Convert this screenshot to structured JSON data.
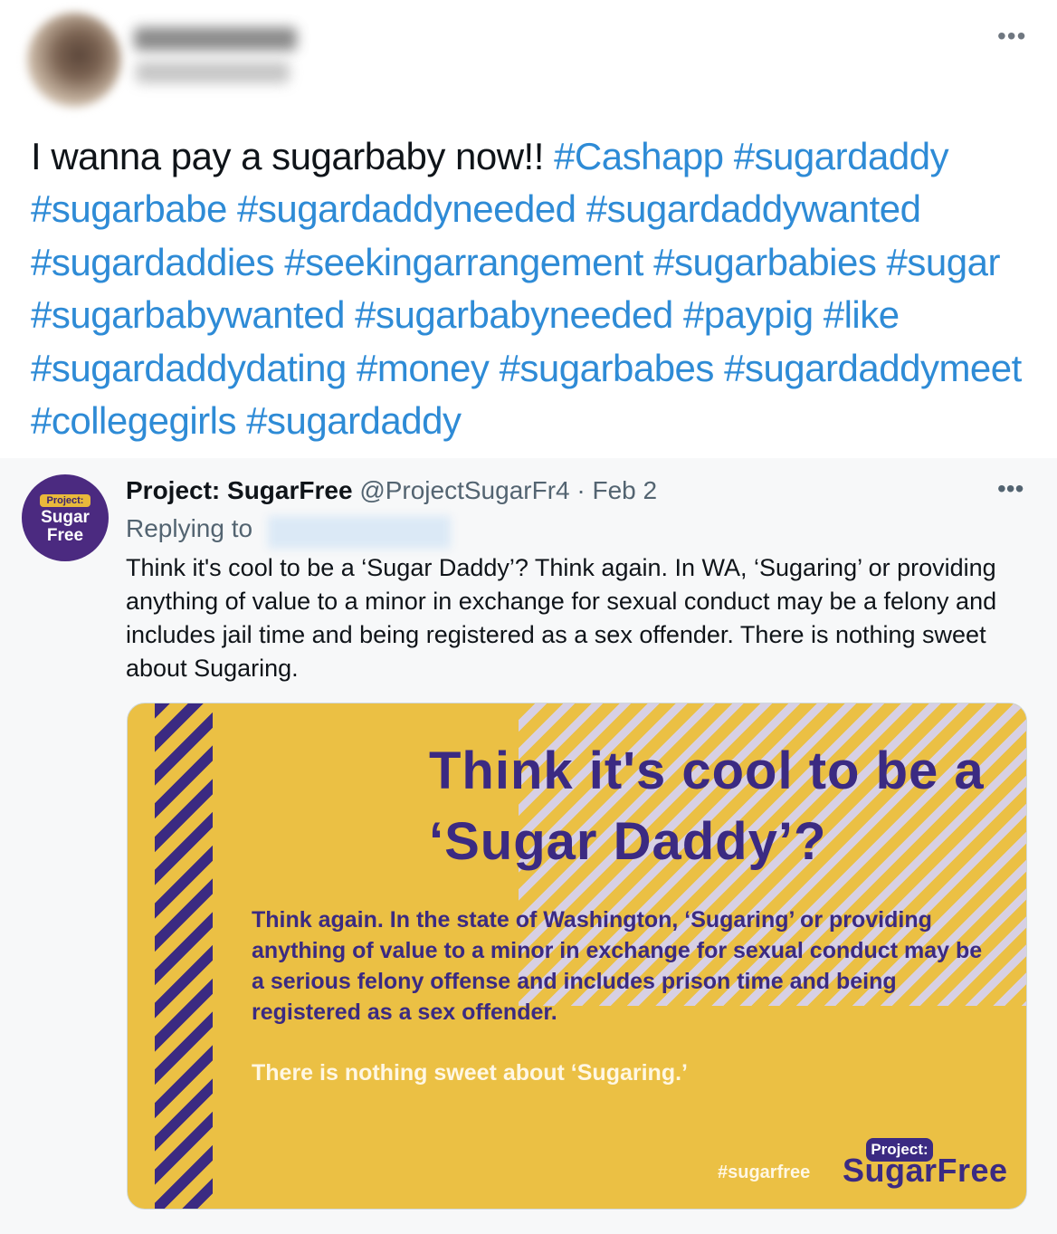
{
  "original_tweet": {
    "more_label": "•••",
    "text": "I wanna pay a sugarbaby now!!",
    "hashtags": [
      "#Cashapp",
      "#sugardaddy",
      "#sugarbabe",
      "#sugardaddyneeded",
      "#sugardaddywanted",
      "#sugardaddies",
      "#seekingarrangement",
      "#sugarbabies",
      "#sugar",
      "#sugarbabywanted",
      "#sugarbabyneeded",
      "#paypig",
      "#like",
      "#sugardaddydating",
      "#money",
      "#sugarbabes",
      "#sugardaddymeet",
      "#collegegirls",
      "#sugardaddy"
    ]
  },
  "reply": {
    "logo": {
      "top": "Project:",
      "line1": "Sugar",
      "line2": "Free"
    },
    "name": "Project: SugarFree",
    "handle": "@ProjectSugarFr4",
    "separator": "·",
    "date": "Feb 2",
    "more_label": "•••",
    "replying_to": "Replying to",
    "body": "Think it's cool to be a ‘Sugar Daddy’? Think again. In WA, ‘Sugaring’ or providing anything of value to a minor in exchange for sexual conduct may be a felony and includes jail time and being registered as a sex offender. There is nothing sweet about Sugaring."
  },
  "card": {
    "headline": "Think it's cool to be a ‘Sugar Daddy’?",
    "body": "Think again. In the state of Washington, ‘Sugaring’ or providing anything of value to a minor in exchange for sexual conduct may be a serious felony offense and includes prison time  and being registered as a sex offender.",
    "footer": "There is nothing sweet about ‘Sugaring.’",
    "hashtag": "#sugarfree",
    "brand_top": "Project:",
    "brand_name": "SugarFree"
  },
  "colors": {
    "link": "#2e8bd6",
    "purple": "#3b2a82",
    "yellow": "#ebc044"
  }
}
